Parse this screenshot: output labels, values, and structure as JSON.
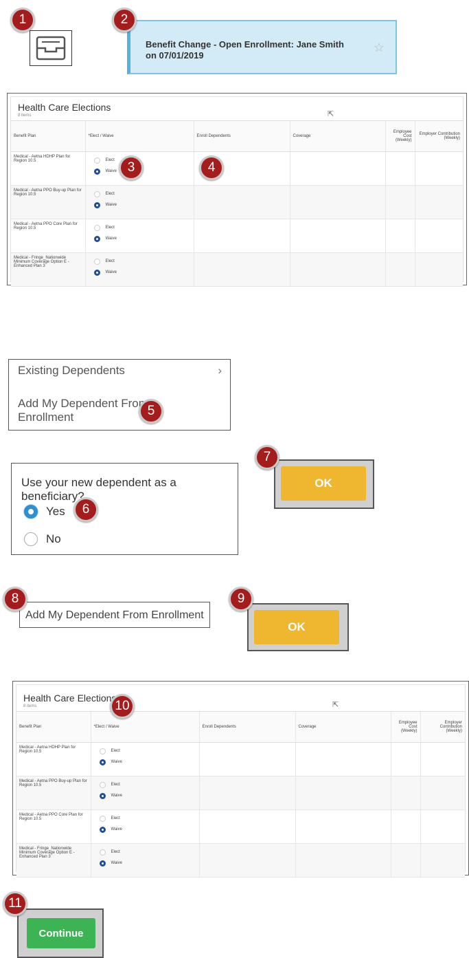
{
  "badges": [
    "1",
    "2",
    "3",
    "4",
    "5",
    "6",
    "7",
    "8",
    "9",
    "10",
    "11"
  ],
  "task": {
    "title": "Benefit Change - Open Enrollment: Jane Smith on 07/01/2019"
  },
  "table": {
    "title": "Health Care Elections",
    "subtitle": "8 items",
    "headers": {
      "plan": "Benefit Plan",
      "elect": "*Elect / Waive",
      "dependents": "Enroll Dependents",
      "coverage": "Coverage",
      "employee_cost": "Employee Cost (Weekly)",
      "employer_contribution": "Employer Contribution (Weekly)"
    },
    "elect_label": "Elect",
    "waive_label": "Waive",
    "rows": [
      {
        "plan": "Medical - Aetna HDHP Plan for Region 10.5",
        "selected": "Waive"
      },
      {
        "plan": "Medical - Aetna PPO Buy-up Plan for Region 10.5",
        "selected": "Waive"
      },
      {
        "plan": "Medical - Aetna PPO Core Plan for Region 10.5",
        "selected": "Waive"
      },
      {
        "plan": "Medical - Fringe_Nationwide Minimum Coverage Option E - Enhanced Plan 3",
        "selected": "Waive"
      }
    ]
  },
  "dependents_menu": {
    "existing": "Existing Dependents",
    "add": "Add My Dependent From Enrollment"
  },
  "beneficiary": {
    "question": "Use your new dependent as a beneficiary?",
    "yes": "Yes",
    "no": "No",
    "selected": "Yes"
  },
  "ok_label": "OK",
  "add_field_value": "Add My Dependent From Enrollment",
  "continue_label": "Continue"
}
